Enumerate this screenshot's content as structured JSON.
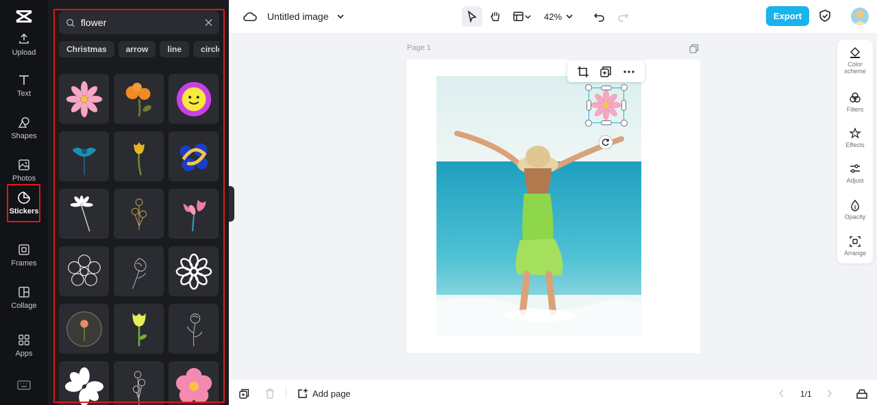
{
  "rail": {
    "items": [
      {
        "label": "Upload",
        "icon": "upload-icon"
      },
      {
        "label": "Text",
        "icon": "text-icon"
      },
      {
        "label": "Shapes",
        "icon": "shapes-icon"
      },
      {
        "label": "Photos",
        "icon": "photos-icon"
      },
      {
        "label": "Stickers",
        "icon": "stickers-icon",
        "active": true
      },
      {
        "label": "Frames",
        "icon": "frames-icon"
      },
      {
        "label": "Collage",
        "icon": "collage-icon"
      },
      {
        "label": "Apps",
        "icon": "apps-icon"
      }
    ]
  },
  "panel": {
    "search_value": "flower",
    "chips": [
      "Christmas",
      "arrow",
      "line",
      "circle"
    ],
    "stickers": [
      "pink-daisy",
      "orange-flowers",
      "smiley-flower-badge",
      "blue-dandelion",
      "yellow-tulip",
      "blue-yellow-flower",
      "white-daisy-stem",
      "line-art-bouquet",
      "pink-tulips",
      "flower-outline",
      "sketch-flower",
      "white-flower-outline",
      "flower-in-globe",
      "yellow-bud",
      "line-art-flower",
      "white-flower",
      "line-art-roses",
      "pink-flower"
    ]
  },
  "topbar": {
    "title": "Untitled image",
    "zoom": "42%",
    "export_label": "Export"
  },
  "canvas": {
    "page_label": "Page 1"
  },
  "right_panel": {
    "items": [
      {
        "label": "Color scheme",
        "icon": "color-scheme-icon"
      },
      {
        "label": "Filters",
        "icon": "filters-icon"
      },
      {
        "label": "Effects",
        "icon": "effects-icon"
      },
      {
        "label": "Adjust",
        "icon": "adjust-icon"
      },
      {
        "label": "Opacity",
        "icon": "opacity-icon"
      },
      {
        "label": "Arrange",
        "icon": "arrange-icon"
      }
    ]
  },
  "bottombar": {
    "add_page_label": "Add page",
    "page_counter": "1/1"
  },
  "colors": {
    "accent": "#19b4ec",
    "highlight": "#e0191e",
    "rail_bg": "#121316",
    "panel_bg": "#1a1b1f"
  }
}
